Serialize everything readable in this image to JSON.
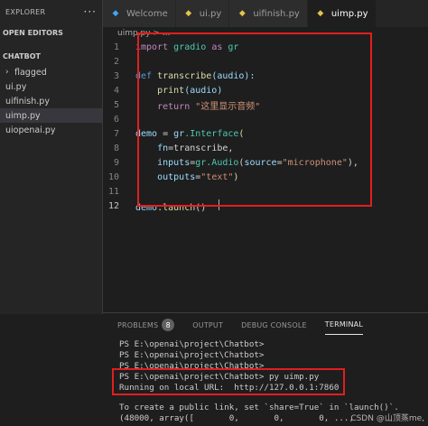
{
  "sidebar": {
    "explorer_label": "EXPLORER",
    "more_icon": "more-icon",
    "open_editors_label": "OPEN EDITORS",
    "folder_label": "CHATBOT",
    "items": [
      {
        "label": "flagged",
        "type": "folder"
      },
      {
        "label": "ui.py",
        "type": "file"
      },
      {
        "label": "uifinish.py",
        "type": "file"
      },
      {
        "label": "uimp.py",
        "type": "file",
        "active": true
      },
      {
        "label": "uiopenai.py",
        "type": "file"
      }
    ]
  },
  "tabs": [
    {
      "label": "Welcome",
      "icon": "vscode-icon"
    },
    {
      "label": "ui.py",
      "icon": "python-icon"
    },
    {
      "label": "uifinish.py",
      "icon": "python-icon"
    },
    {
      "label": "uimp.py",
      "icon": "python-icon",
      "active": true
    }
  ],
  "breadcrumb": "uimp.py > ...",
  "editor": {
    "line_numbers": [
      "1",
      "2",
      "3",
      "4",
      "5",
      "6",
      "7",
      "8",
      "9",
      "10",
      "11",
      "12"
    ],
    "lines": {
      "l1": {
        "kw": "import",
        "mod": "gradio",
        "as": "as",
        "alias": "gr"
      },
      "l3": {
        "kw": "def",
        "fn": "transcribe",
        "args": "(audio):"
      },
      "l4": {
        "fn": "print",
        "args": "(audio)"
      },
      "l5": {
        "kw": "return",
        "str": "\"这里显示音频\""
      },
      "l7": {
        "var": "demo",
        "eq": " = ",
        "mod": "gr",
        "cls": ".Interface",
        "open": "("
      },
      "l8": {
        "var": "fn",
        "eq": "=",
        "val": "transcribe,"
      },
      "l9": {
        "var": "inputs",
        "eq": "=",
        "call": "gr.Audio",
        "kwarg": "source",
        "str": "\"microphone\"",
        "end": "),"
      },
      "l10": {
        "var": "outputs",
        "eq": "=",
        "str": "\"text\"",
        "end": ")"
      },
      "l12": {
        "var": "demo",
        "fn": ".launch",
        "args": "()"
      }
    }
  },
  "panel": {
    "tabs": [
      {
        "label": "PROBLEMS",
        "badge": "8"
      },
      {
        "label": "OUTPUT"
      },
      {
        "label": "DEBUG CONSOLE"
      },
      {
        "label": "TERMINAL",
        "active": true
      }
    ],
    "terminal_lines": [
      "PS E:\\openai\\project\\Chatbot>",
      "PS E:\\openai\\project\\Chatbot>",
      "PS E:\\openai\\project\\Chatbot>",
      "PS E:\\openai\\project\\Chatbot> py uimp.py",
      "Running on local URL:  http://127.0.0.1:7860",
      "",
      "To create a public link, set `share=True` in `launch()`.",
      "(48000, array([       0,       0,       0, ...,"
    ]
  },
  "watermark": "CSDN @山顶蒸me,",
  "colors": {
    "highlight_box": "#e21e1e",
    "accent": "#007acc"
  }
}
